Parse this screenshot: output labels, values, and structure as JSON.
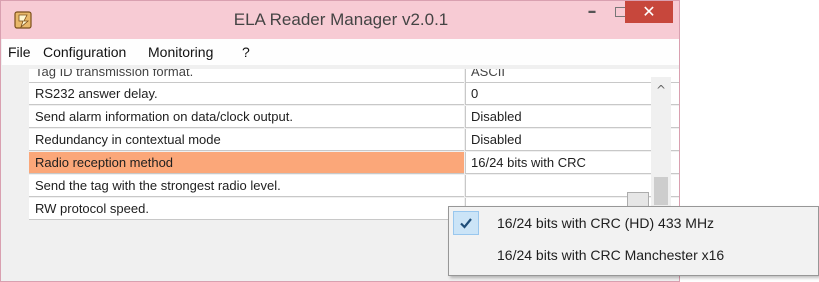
{
  "window": {
    "title": "ELA Reader Manager v2.0.1",
    "minimize_glyph": "–",
    "close_glyph": "✕",
    "icon": "app-icon",
    "titlebar_color": "#f7cbd4",
    "close_color": "#c7473c"
  },
  "menu": {
    "items": [
      "File",
      "Configuration",
      "Monitoring",
      "?"
    ]
  },
  "grid": {
    "rows": [
      {
        "name": "Tag ID transmission format.",
        "value": "ASCII"
      },
      {
        "name": "RS232 answer delay.",
        "value": "0"
      },
      {
        "name": "Send alarm information on data/clock output.",
        "value": "Disabled"
      },
      {
        "name": "Redundancy in contextual mode",
        "value": "Disabled"
      },
      {
        "name": "Radio reception method",
        "value": "16/24 bits with CRC"
      },
      {
        "name": "Send the tag with the strongest radio level.",
        "value": ""
      },
      {
        "name": "RW protocol speed.",
        "value": ""
      }
    ],
    "selected_color": "#fba779"
  },
  "scrollbar": {
    "up_glyph": "^"
  },
  "dropdown": {
    "options": [
      {
        "label": "16/24 bits with CRC (HD) 433 MHz",
        "checked": true
      },
      {
        "label": "16/24 bits with CRC Manchester x16",
        "checked": false
      }
    ],
    "check_glyph": "✔",
    "check_color": "#1f4e79"
  }
}
